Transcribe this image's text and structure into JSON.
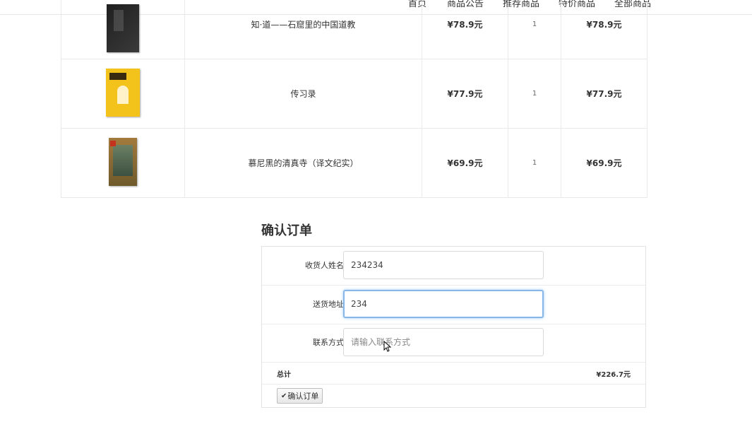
{
  "nav": {
    "items": [
      "首页",
      "商品公告",
      "推荐商品",
      "特价商品",
      "全部商品"
    ]
  },
  "cart": {
    "rows": [
      {
        "name": "知·道——石窟里的中国道教",
        "price": "¥78.9元",
        "qty": "1",
        "subtotal": "¥78.9元",
        "cover": "book-cover-dark"
      },
      {
        "name": "传习录",
        "price": "¥77.9元",
        "qty": "1",
        "subtotal": "¥77.9元",
        "cover": "book-cover-yellow"
      },
      {
        "name": "慕尼黑的清真寺（译文纪实）",
        "price": "¥69.9元",
        "qty": "1",
        "subtotal": "¥69.9元",
        "cover": "book-cover-olive"
      }
    ]
  },
  "order": {
    "title": "确认订单",
    "name_label": "收货人姓名",
    "name_value": "234234",
    "address_label": "送货地址",
    "address_value": "234",
    "contact_label": "联系方式",
    "contact_placeholder": "请输入联系方式",
    "contact_value": "",
    "total_label": "总计",
    "total_value": "¥226.7元",
    "confirm_button": "确认订单",
    "confirm_icon": "check-icon"
  },
  "colors": {
    "focus_border": "#86b7e8",
    "border": "#e3e3e3"
  }
}
